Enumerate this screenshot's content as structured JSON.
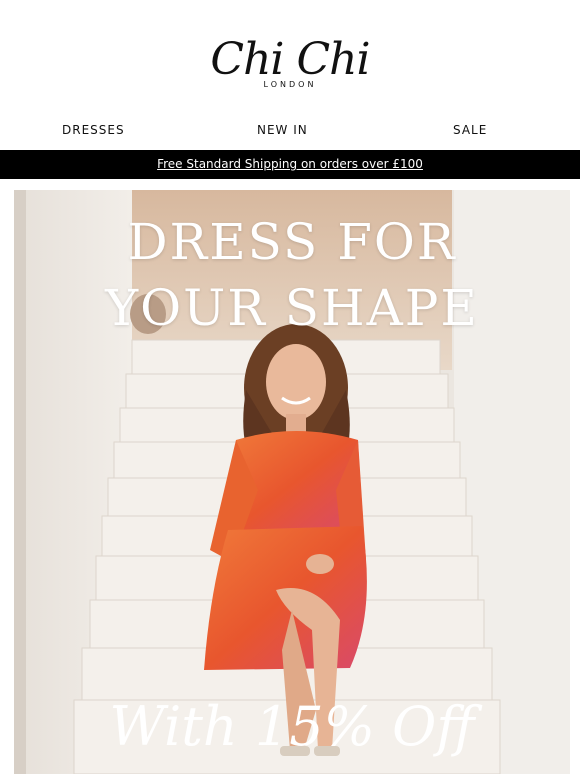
{
  "brand": {
    "name": "Chi Chi",
    "sub": "LONDON"
  },
  "nav": {
    "items": [
      {
        "label": "DRESSES"
      },
      {
        "label": "NEW IN"
      },
      {
        "label": "SALE"
      }
    ]
  },
  "shipping": {
    "text": "Free Standard Shipping on orders over £100"
  },
  "hero": {
    "title_line1": "DRESS FOR",
    "title_line2": "YOUR SHAPE",
    "offer": "With 15% Off"
  },
  "colors": {
    "shipping_bar": "#000000",
    "hero_text": "#ffffff",
    "dress": "#ec6a2c"
  }
}
